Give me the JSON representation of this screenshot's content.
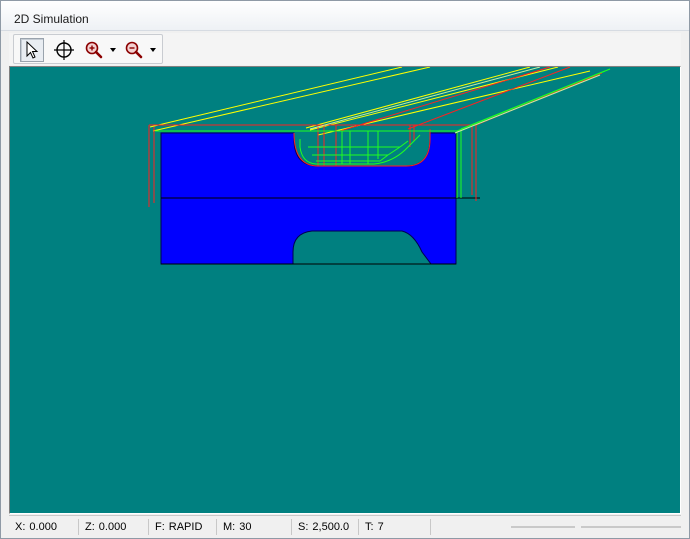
{
  "window": {
    "title": "2D Simulation"
  },
  "toolbar": {
    "buttons": [
      {
        "icon": "select-arrow-icon",
        "state": "active"
      },
      {
        "icon": "crosshair-icon"
      },
      {
        "icon": "zoom-in-icon"
      },
      {
        "icon": "zoom-out-icon"
      }
    ]
  },
  "canvas": {
    "background": "#008080",
    "part_color": "#0000ff",
    "toolpath_colors": {
      "feed": "#ffff00",
      "rapid": "#ff0000",
      "cut": "#00ff00"
    }
  },
  "status": {
    "x_label": "X:",
    "x_value": "0.000",
    "z_label": "Z:",
    "z_value": "0.000",
    "f_label": "F:",
    "f_value": "RAPID",
    "m_label": "M:",
    "m_value": "30",
    "s_label": "S:",
    "s_value": "2,500.0",
    "t_label": "T:",
    "t_value": "7"
  }
}
